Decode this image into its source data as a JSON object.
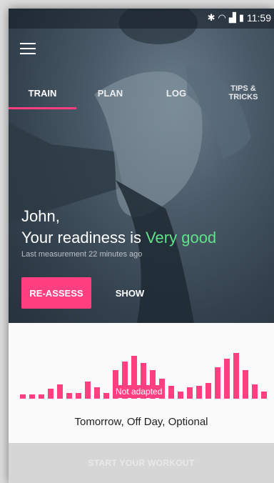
{
  "status_bar": {
    "time": "11:59",
    "icons": [
      "bluetooth-icon",
      "wifi-icon",
      "signal-icon",
      "battery-icon"
    ]
  },
  "tabs": [
    {
      "label": "TRAIN",
      "active": true
    },
    {
      "label": "PLAN",
      "active": false
    },
    {
      "label": "LOG",
      "active": false
    },
    {
      "label": "TIPS &",
      "label2": "TRICKS",
      "active": false
    }
  ],
  "greeting": {
    "name_line": "John,",
    "readiness_prefix": "Your readiness is",
    "readiness_value": "Very good",
    "last_measurement": "Last measurement 22 minutes ago"
  },
  "buttons": {
    "reassess": "RE-ASSESS",
    "show": "SHOW"
  },
  "adaptation": {
    "label": "Not adapted",
    "levels": [
      6,
      6,
      6,
      14,
      20,
      8,
      8,
      24,
      16,
      8,
      40,
      52,
      60,
      50,
      40,
      28,
      18,
      10,
      16,
      18,
      22,
      44,
      56,
      64,
      40,
      20,
      10
    ]
  },
  "tomorrow_text": "Tomorrow, Off Day, Optional",
  "start_button": "START YOUR WORKOUT",
  "colors": {
    "accent": "#ff3f80",
    "readiness": "#5fe28a"
  }
}
